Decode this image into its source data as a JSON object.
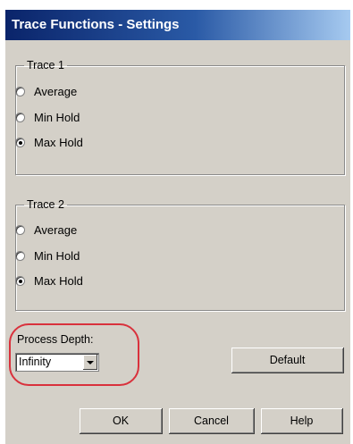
{
  "dialog": {
    "title": "Trace Functions - Settings"
  },
  "trace1": {
    "label": "Trace 1",
    "options": [
      {
        "label": "Average",
        "checked": false
      },
      {
        "label": "Min Hold",
        "checked": false
      },
      {
        "label": "Max Hold",
        "checked": true
      }
    ]
  },
  "trace2": {
    "label": "Trace 2",
    "options": [
      {
        "label": "Average",
        "checked": false
      },
      {
        "label": "Min Hold",
        "checked": false
      },
      {
        "label": "Max Hold",
        "checked": true
      }
    ]
  },
  "process_depth": {
    "label": "Process Depth:",
    "value": "Infinity"
  },
  "buttons": {
    "default": "Default",
    "ok": "OK",
    "cancel": "Cancel",
    "help": "Help"
  },
  "colors": {
    "title_start": "#0a246a",
    "title_end": "#a6caf0",
    "highlight": "#d9313c"
  }
}
